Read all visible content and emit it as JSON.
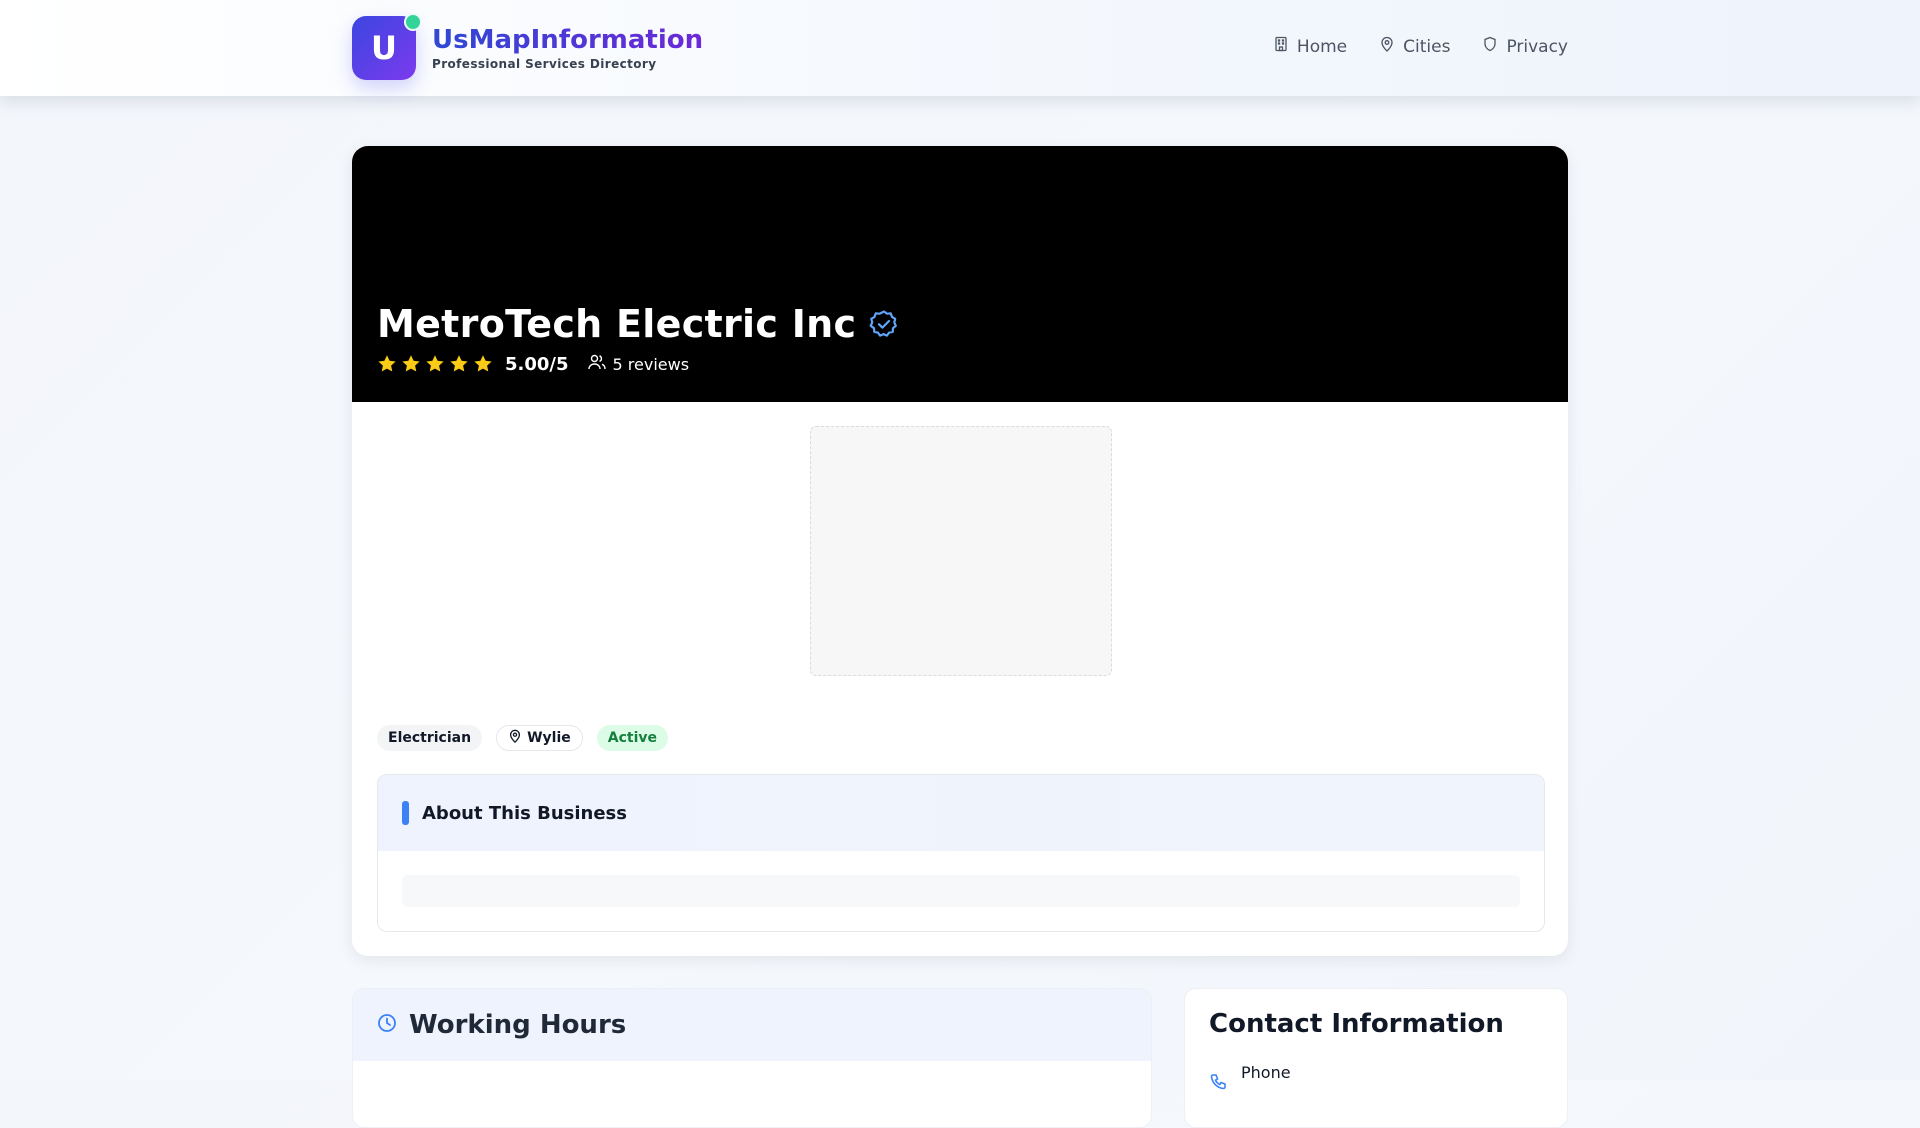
{
  "header": {
    "logo_letter": "U",
    "brand_name": "UsMapInformation",
    "brand_tagline": "Professional Services Directory",
    "nav": [
      {
        "label": "Home",
        "icon": "building-icon"
      },
      {
        "label": "Cities",
        "icon": "map-pin-icon"
      },
      {
        "label": "Privacy",
        "icon": "shield-icon"
      }
    ]
  },
  "business": {
    "name": "MetroTech Electric Inc",
    "verified_icon": "verified-badge-icon",
    "rating": 5,
    "rating_max": 5,
    "rating_label": "5.00/5",
    "reviews_label": "5 reviews",
    "tags": {
      "category": "Electrician",
      "city": "Wylie",
      "status": "Active"
    },
    "about_title": "About This Business"
  },
  "working_hours": {
    "title": "Working Hours",
    "icon": "clock-icon"
  },
  "contact": {
    "title": "Contact Information",
    "phone_label": "Phone",
    "phone_icon": "phone-icon"
  },
  "colors": {
    "brand_start": "#2f48d4",
    "brand_end": "#6d28d9",
    "accent_blue": "#3b82f6",
    "star": "#facc15",
    "status_bg": "#dcfce7",
    "status_text": "#15803d"
  }
}
